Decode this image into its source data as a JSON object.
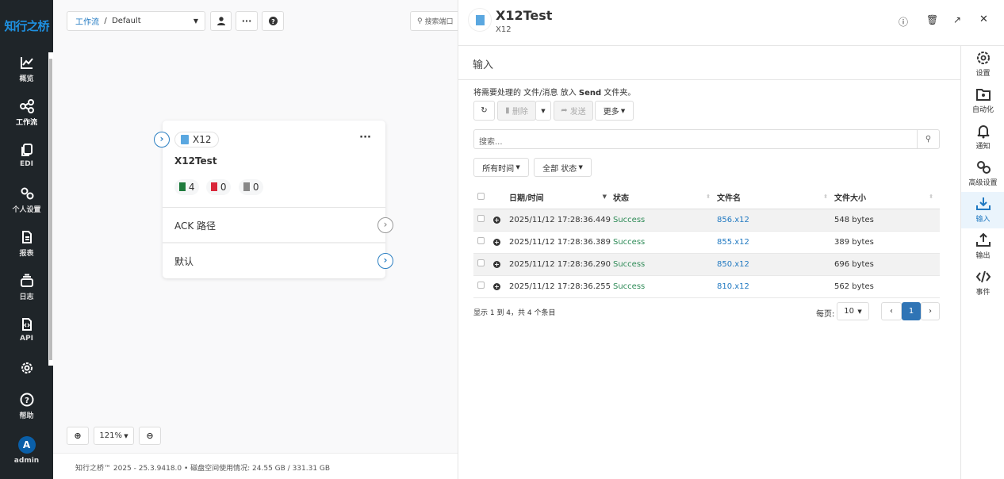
{
  "sidebar": {
    "logo": "知行之桥",
    "items": [
      {
        "label": "概览",
        "icon": "chart-line-icon"
      },
      {
        "label": "工作流",
        "icon": "share-nodes-icon"
      },
      {
        "label": "EDI",
        "icon": "copy-icon"
      },
      {
        "label": "个人设置",
        "icon": "gears-icon"
      },
      {
        "label": "报表",
        "icon": "file-icon"
      },
      {
        "label": "日志",
        "icon": "layers-icon"
      },
      {
        "label": "API",
        "icon": "file-code-icon"
      },
      {
        "label": "",
        "icon": "gear-icon"
      },
      {
        "label": "帮助",
        "icon": "question-circle-icon"
      }
    ],
    "user": {
      "initial": "A",
      "name": "admin"
    }
  },
  "canvas": {
    "breadcrumb": {
      "root": "工作流",
      "sep": "/",
      "current": "Default"
    },
    "search_placeholder": "搜索端口",
    "node": {
      "type": "X12",
      "name": "X12Test",
      "counts": {
        "success": "4",
        "error": "0",
        "pending": "0"
      },
      "paths": [
        "ACK 路径",
        "默认"
      ]
    },
    "zoom": "121%",
    "footer": "知行之桥™ 2025 - 25.3.9418.0  •  磁盘空间使用情况:  24.55 GB / 331.31 GB"
  },
  "panel": {
    "title": "X12Test",
    "subtitle": "X12",
    "section": "输入",
    "hint_pre": "将需要处理的 文件/消息 放入 ",
    "hint_bold": "Send",
    "hint_post": " 文件夹。",
    "toolbar": {
      "delete": "删除",
      "send": "发送",
      "more": "更多"
    },
    "search_placeholder": "搜索...",
    "filters": {
      "time": "所有时间",
      "status": "全部 状态"
    },
    "table": {
      "headers": [
        "日期/时间",
        "状态",
        "文件名",
        "文件大小"
      ],
      "rows": [
        [
          "2025/11/12 17:28:36.449",
          "Success",
          "856.x12",
          "548 bytes"
        ],
        [
          "2025/11/12 17:28:36.389",
          "Success",
          "855.x12",
          "389 bytes"
        ],
        [
          "2025/11/12 17:28:36.290",
          "Success",
          "850.x12",
          "696 bytes"
        ],
        [
          "2025/11/12 17:28:36.255",
          "Success",
          "810.x12",
          "562 bytes"
        ]
      ]
    },
    "summary": "显示 1 到 4，共 4 个条目",
    "per_page_label": "每页:",
    "per_page": "10",
    "page": "1",
    "nav": [
      {
        "label": "设置",
        "icon": "gear-icon"
      },
      {
        "label": "自动化",
        "icon": "folder-gear-icon"
      },
      {
        "label": "通知",
        "icon": "bell-icon"
      },
      {
        "label": "高级设置",
        "icon": "gears-icon"
      },
      {
        "label": "输入",
        "icon": "download-icon",
        "active": true
      },
      {
        "label": "输出",
        "icon": "upload-icon"
      },
      {
        "label": "事件",
        "icon": "code-icon"
      }
    ]
  },
  "colors": {
    "accent": "#1f78c1",
    "sidebar": "#1f2529",
    "success": "#2e8b57"
  }
}
